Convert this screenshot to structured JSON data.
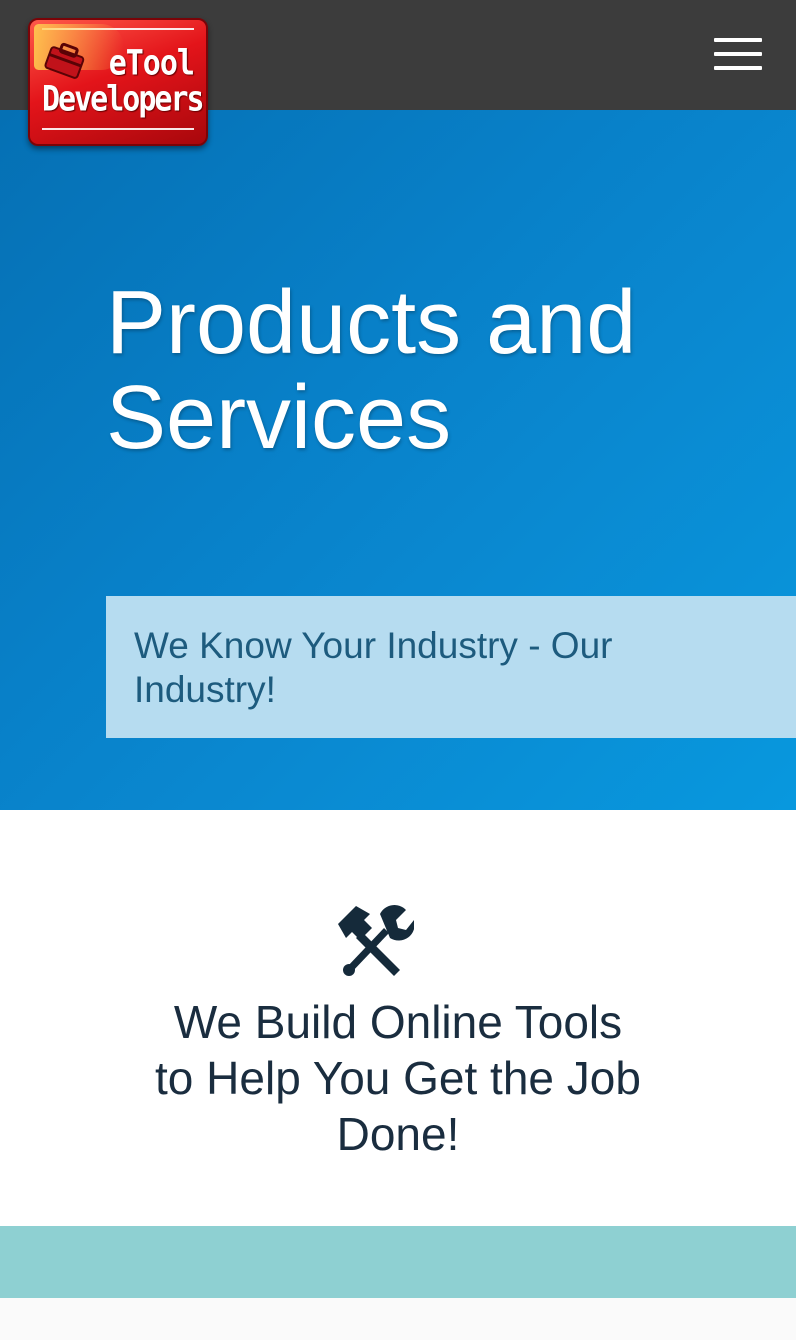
{
  "header": {
    "logo": {
      "line1": "eTool",
      "line2": "Developers"
    },
    "menu_icon": "hamburger-menu-icon"
  },
  "hero": {
    "title": "Products and Services",
    "tagline": "We Know Your Industry - Our Industry!"
  },
  "feature": {
    "icon": "hammer-wrench-icon",
    "title": "We Build Online Tools to Help You Get the Job Done!"
  },
  "colors": {
    "topbar": "#3c3c3c",
    "hero_blue": "#0880c8",
    "tagline_bg": "#b6dcf0",
    "tagline_text": "#1d5b7e",
    "heading_text": "#1a2d3f",
    "band": "#8ed0d2",
    "logo_red": "#e3141a"
  }
}
